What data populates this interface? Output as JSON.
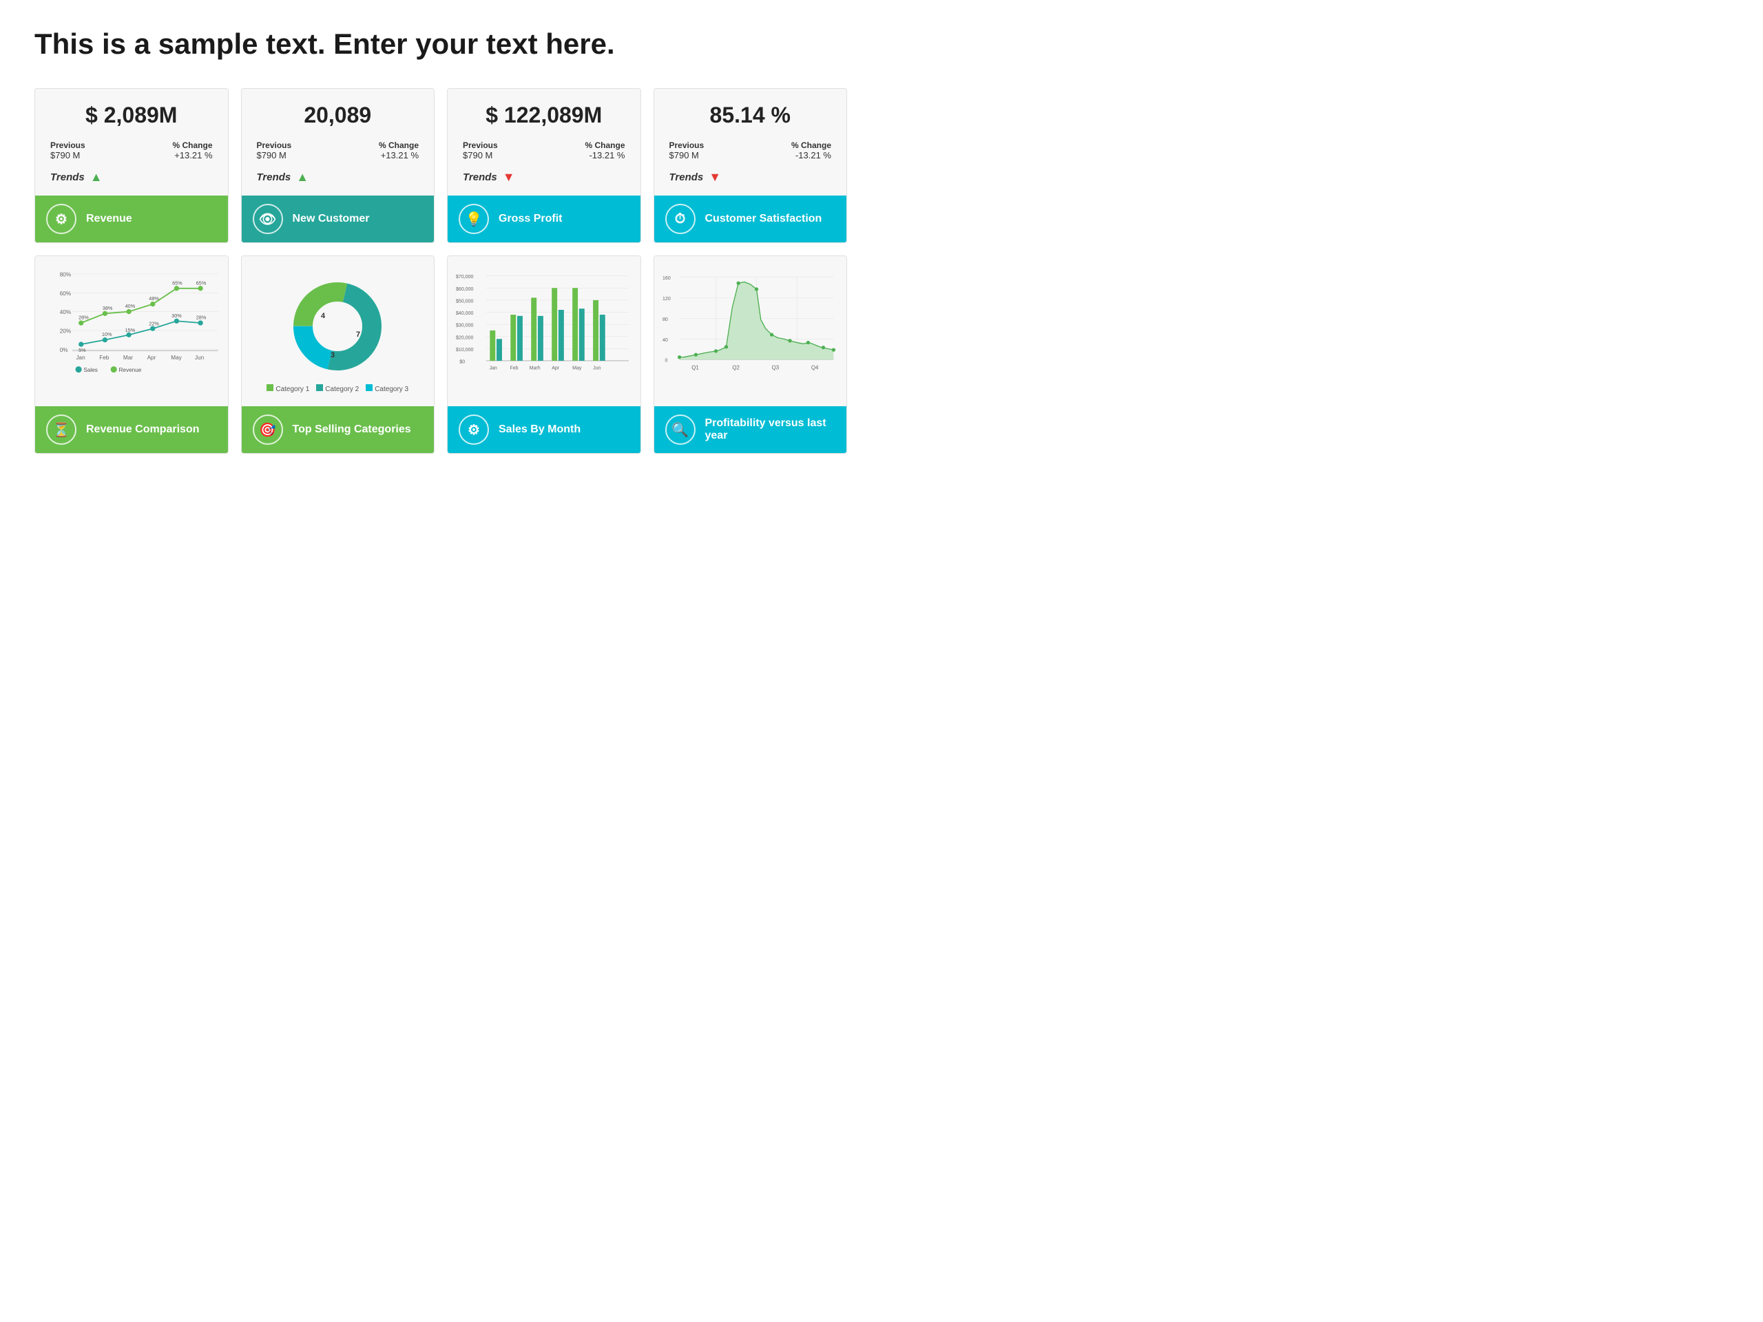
{
  "title": "This is a sample text. Enter your text here.",
  "kpi_cards": [
    {
      "value": "$ 2,089M",
      "previous_label": "Previous",
      "previous_value": "$790 M",
      "change_label": "% Change",
      "change_value": "+13.21 %",
      "trend_label": "Trends",
      "trend_up": true,
      "footer_label": "Revenue",
      "footer_color": "green",
      "icon": "⚙"
    },
    {
      "value": "20,089",
      "previous_label": "Previous",
      "previous_value": "$790 M",
      "change_label": "% Change",
      "change_value": "+13.21 %",
      "trend_label": "Trends",
      "trend_up": true,
      "footer_label": "New Customer",
      "footer_color": "teal",
      "icon": "👁"
    },
    {
      "value": "$ 122,089M",
      "previous_label": "Previous",
      "previous_value": "$790 M",
      "change_label": "% Change",
      "change_value": "-13.21 %",
      "trend_label": "Trends",
      "trend_up": false,
      "footer_label": "Gross Profit",
      "footer_color": "blue-teal",
      "icon": "💡"
    },
    {
      "value": "85.14 %",
      "previous_label": "Previous",
      "previous_value": "$790 M",
      "change_label": "% Change",
      "change_value": "-13.21 %",
      "trend_label": "Trends",
      "trend_up": false,
      "footer_label": "Customer Satisfaction",
      "footer_color": "blue-teal",
      "icon": "⏱"
    }
  ],
  "chart_cards": [
    {
      "footer_label": "Revenue Comparison",
      "footer_color": "green",
      "icon": "⏳",
      "type": "line"
    },
    {
      "footer_label": "Top Selling Categories",
      "footer_color": "green",
      "icon": "🎯",
      "type": "donut"
    },
    {
      "footer_label": "Sales By Month",
      "footer_color": "blue-teal",
      "icon": "⚙",
      "type": "bar"
    },
    {
      "footer_label": "Profitability versus last year",
      "footer_color": "blue-teal",
      "icon": "🔍",
      "type": "profitability"
    }
  ],
  "line_chart": {
    "months": [
      "Jan",
      "Feb",
      "Mar",
      "Apr",
      "May",
      "Jun"
    ],
    "sales": [
      5,
      10,
      15,
      22,
      30,
      28
    ],
    "revenue": [
      28,
      38,
      40,
      48,
      65,
      65
    ]
  },
  "donut": {
    "segments": [
      {
        "label": "Category 1",
        "value": 4,
        "color": "#6abf4b"
      },
      {
        "label": "Category 2",
        "value": 7,
        "color": "#26a69a"
      },
      {
        "label": "Category 3",
        "value": 3,
        "color": "#00bcd4"
      }
    ]
  },
  "bar_chart": {
    "months": [
      "Jan",
      "Feb",
      "Marh",
      "Apr",
      "May",
      "Jun"
    ],
    "series1": [
      25000,
      38000,
      52000,
      60000,
      60000,
      50000
    ],
    "series2": [
      18000,
      37000,
      37000,
      42000,
      43000,
      38000
    ],
    "yLabels": [
      "$0",
      "$10,000",
      "$20,000",
      "$30,000",
      "$40,000",
      "$50,000",
      "$60,000",
      "$70,000"
    ]
  },
  "prof_chart": {
    "quarters": [
      "Q1",
      "Q2",
      "Q3",
      "Q4"
    ],
    "yLabels": [
      "0",
      "40",
      "80",
      "120",
      "160"
    ]
  }
}
